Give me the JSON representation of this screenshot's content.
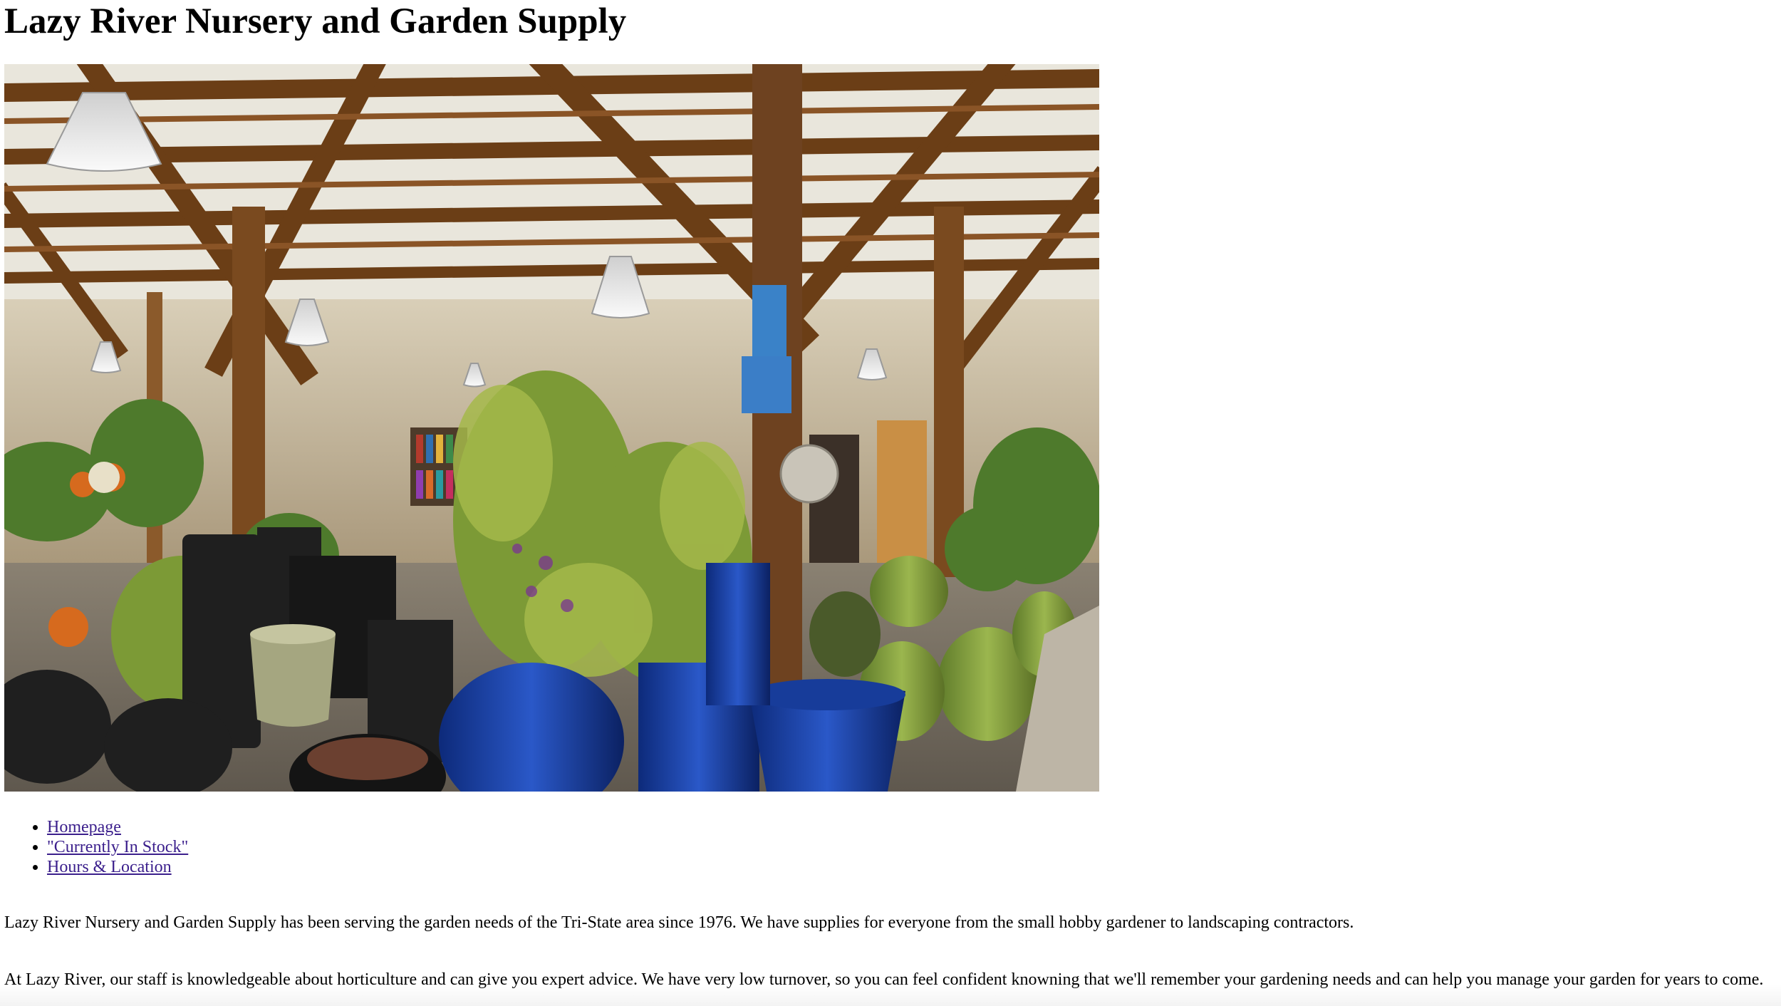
{
  "page": {
    "title": "Lazy River Nursery and Garden Supply"
  },
  "nav": {
    "items": [
      {
        "label": "Homepage"
      },
      {
        "label": "\"Currently In Stock\""
      },
      {
        "label": "Hours & Location"
      }
    ]
  },
  "content": {
    "paragraph1": "Lazy River Nursery and Garden Supply has been serving the garden needs of the Tri-State area since 1976. We have supplies for everyone from the small hobby gardener to landscaping contractors.",
    "paragraph2": "At Lazy River, our staff is knowledgeable about horticulture and can give you expert advice. We have very low turnover, so you can feel confident knowning that we'll remember your gardening needs and can help you manage your garden for years to come."
  },
  "colors": {
    "link": "#3b1f8c",
    "text": "#000000",
    "background": "#ffffff"
  }
}
